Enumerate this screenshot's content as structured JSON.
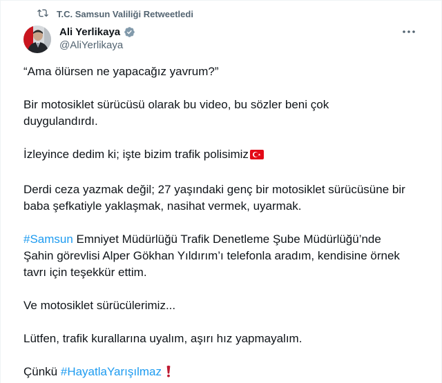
{
  "retweet": {
    "label": "T.C. Samsun Valiliği Retweetledi",
    "icon": "retweet-icon"
  },
  "author": {
    "name": "Ali Yerlikaya",
    "handle": "@AliYerlikaya",
    "verified_color": "#829aab"
  },
  "menu": {
    "icon": "more-icon"
  },
  "tweet": {
    "p1": "“Ama ölürsen ne yapacağız yavrum?”",
    "p2_line1": "Bir motosiklet sürücüsü olarak bu video, bu sözler beni çok",
    "p2_line2": "duygulandırdı.",
    "p3": "İzleyince dedim ki; işte bizim trafik polisimiz",
    "p4_line1": "Derdi ceza yazmak değil; 27 yaşındaki genç bir motosiklet sürücüsüne bir",
    "p4_line2": "baba şefkatiyle yaklaşmak, nasihat vermek, uyarmak.",
    "p5_hashtag": "#Samsun",
    "p5_line1_rest": " Emniyet Müdürlüğü Trafik Denetleme Şube Müdürlüğü’nde",
    "p5_line2": "Şahin görevlisi Alper Gökhan Yıldırım’ı telefonla aradım, kendisine örnek",
    "p5_line3": "tavrı için teşekkür ettim.",
    "p6": "Ve motosiklet sürücülerimiz...",
    "p7": "Lütfen, trafik kurallarına uyalım, aşırı hız yapmayalım.",
    "p8_prefix": "Çünkü ",
    "p8_hashtag": "#HayatlaYarışılmaz"
  },
  "colors": {
    "text": "#0f1419",
    "secondary": "#536471",
    "link": "#1d9bf0",
    "flag_red": "#e30a17",
    "exclaim_red": "#be1931"
  }
}
